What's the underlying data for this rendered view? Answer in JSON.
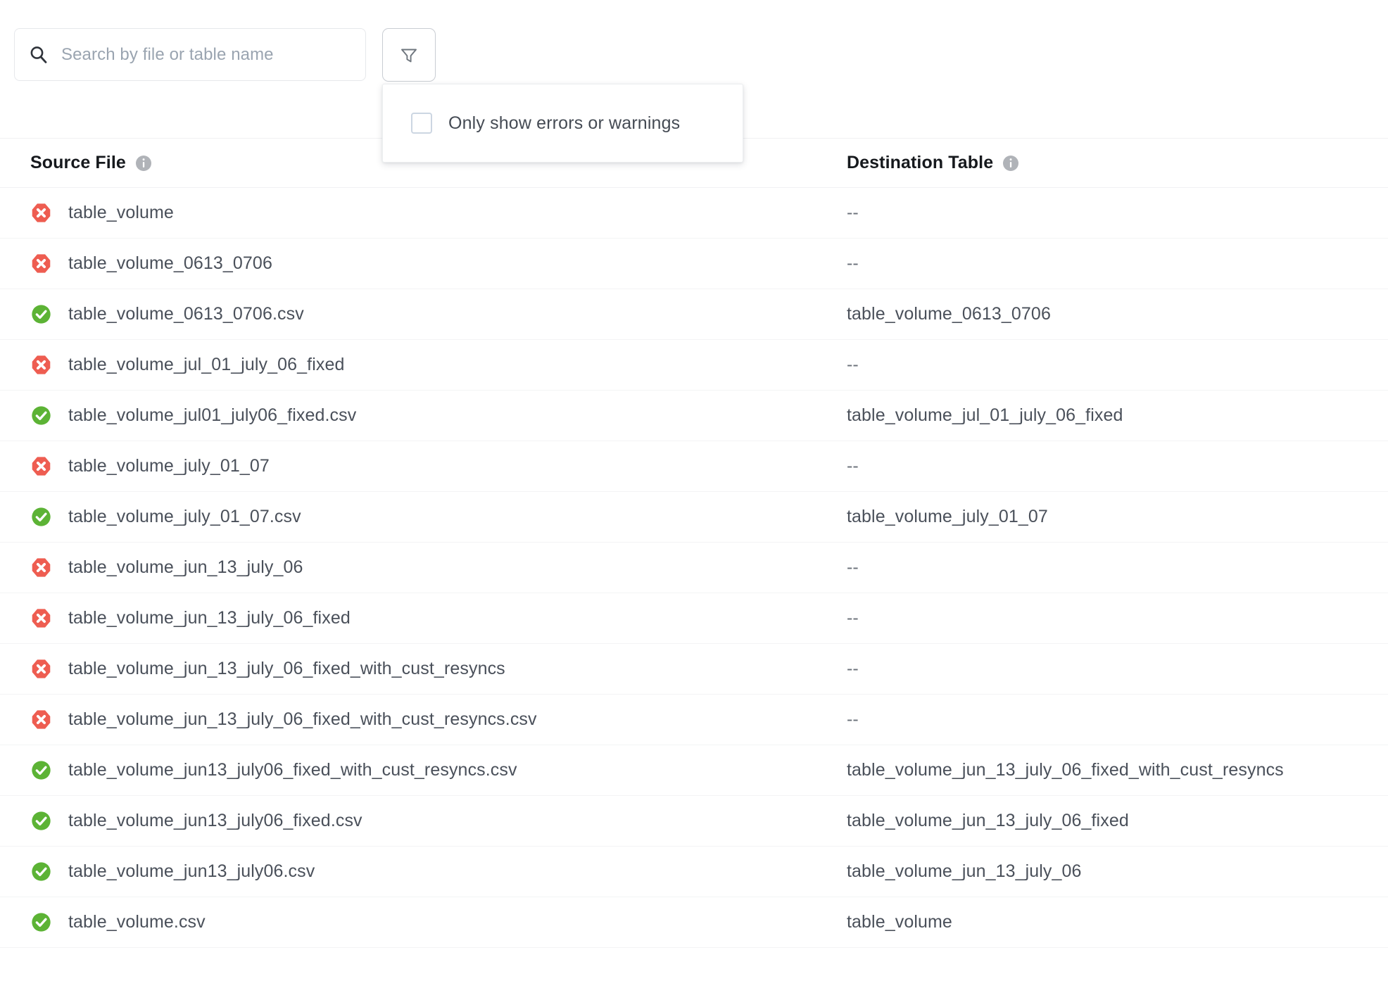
{
  "search": {
    "placeholder": "Search by file or table name",
    "value": "",
    "icon": "search-icon"
  },
  "filter": {
    "button_icon": "funnel-icon",
    "dropdown": {
      "checkbox_label": "Only show errors or warnings",
      "checked": false
    }
  },
  "table": {
    "columns": [
      {
        "label": "Source File",
        "info_icon": "info-icon"
      },
      {
        "label": "Destination Table",
        "info_icon": "info-icon"
      }
    ],
    "empty_value": "--",
    "rows": [
      {
        "status": "error",
        "source": "table_volume",
        "destination": "--"
      },
      {
        "status": "error",
        "source": "table_volume_0613_0706",
        "destination": "--"
      },
      {
        "status": "success",
        "source": "table_volume_0613_0706.csv",
        "destination": "table_volume_0613_0706"
      },
      {
        "status": "error",
        "source": "table_volume_jul_01_july_06_fixed",
        "destination": "--"
      },
      {
        "status": "success",
        "source": "table_volume_jul01_july06_fixed.csv",
        "destination": "table_volume_jul_01_july_06_fixed"
      },
      {
        "status": "error",
        "source": "table_volume_july_01_07",
        "destination": "--"
      },
      {
        "status": "success",
        "source": "table_volume_july_01_07.csv",
        "destination": "table_volume_july_01_07"
      },
      {
        "status": "error",
        "source": "table_volume_jun_13_july_06",
        "destination": "--"
      },
      {
        "status": "error",
        "source": "table_volume_jun_13_july_06_fixed",
        "destination": "--"
      },
      {
        "status": "error",
        "source": "table_volume_jun_13_july_06_fixed_with_cust_resyncs",
        "destination": "--"
      },
      {
        "status": "error",
        "source": "table_volume_jun_13_july_06_fixed_with_cust_resyncs.csv",
        "destination": "--"
      },
      {
        "status": "success",
        "source": "table_volume_jun13_july06_fixed_with_cust_resyncs.csv",
        "destination": "table_volume_jun_13_july_06_fixed_with_cust_resyncs"
      },
      {
        "status": "success",
        "source": "table_volume_jun13_july06_fixed.csv",
        "destination": "table_volume_jun_13_july_06_fixed"
      },
      {
        "status": "success",
        "source": "table_volume_jun13_july06.csv",
        "destination": "table_volume_jun_13_july_06"
      },
      {
        "status": "success",
        "source": "table_volume.csv",
        "destination": "table_volume"
      }
    ]
  },
  "colors": {
    "error": "#ee5d51",
    "success": "#5cb335",
    "info": "#b0b3b8",
    "text": "#4a505a",
    "header_text": "#16191d",
    "placeholder": "#9aa4b0",
    "border": "#f0f1f3"
  }
}
